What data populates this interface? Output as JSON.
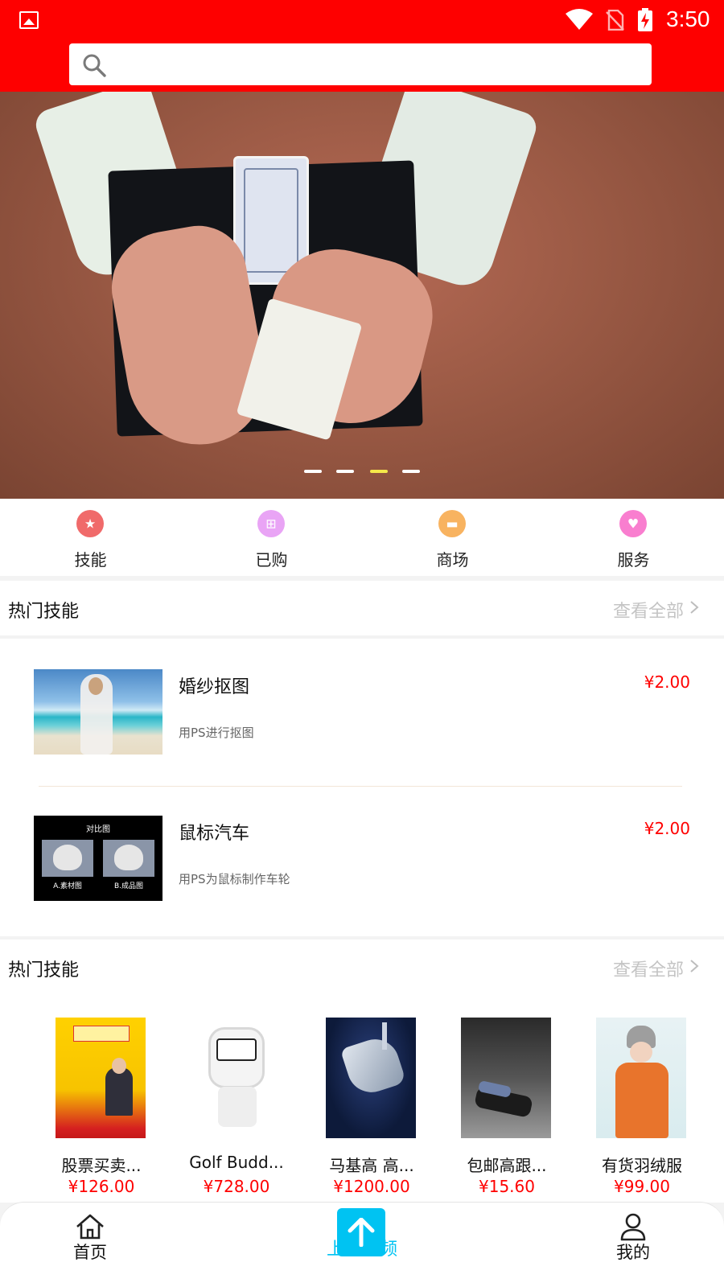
{
  "status_bar": {
    "time": "3:50"
  },
  "search": {
    "placeholder": ""
  },
  "banner": {
    "slide_count": 4,
    "active_slide": 3
  },
  "nav": [
    {
      "label": "技能",
      "icon": "skills-icon",
      "color": "#f06a6a"
    },
    {
      "label": "已购",
      "icon": "purchased-icon",
      "color": "#e9a4f5"
    },
    {
      "label": "商场",
      "icon": "mall-icon",
      "color": "#f8b360"
    },
    {
      "label": "服务",
      "icon": "service-icon",
      "color": "#f97ecf"
    }
  ],
  "section1": {
    "title": "热门技能",
    "more": "查看全部"
  },
  "skills": [
    {
      "name": "婚纱抠图",
      "desc": "用PS进行抠图",
      "price": "¥2.00"
    },
    {
      "name": "鼠标汽车",
      "desc": "用PS为鼠标制作车轮",
      "price": "¥2.00",
      "thumb_caption": "对比图",
      "thumb_labels": [
        "A.素材图",
        "B.成品图"
      ]
    }
  ],
  "section2": {
    "title": "热门技能",
    "more": "查看全部"
  },
  "products": [
    {
      "name": "股票买卖...",
      "price": "¥126.00"
    },
    {
      "name": "Golf Budd...",
      "price": "¥728.00"
    },
    {
      "name": "马基高 高...",
      "price": "¥1200.00"
    },
    {
      "name": "包邮高跟...",
      "price": "¥15.60"
    },
    {
      "name": "有货羽绒服",
      "price": "¥99.00"
    }
  ],
  "tabbar": {
    "home": "首页",
    "upload": "上传视频",
    "me": "我的",
    "accent": "#00c3f2"
  },
  "colors": {
    "header": "#fe0000",
    "price": "#ff0000"
  }
}
